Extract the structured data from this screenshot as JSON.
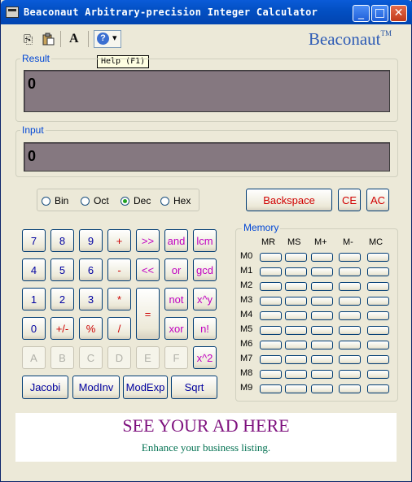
{
  "window": {
    "title": "Beaconaut Arbitrary-precision Integer Calculator",
    "minimize_label": "_",
    "maximize_label": "□",
    "close_label": "✕"
  },
  "toolbar": {
    "copy_icon": "⎘",
    "paste_icon": "📋",
    "font_icon": "A",
    "help_icon": "?",
    "dropdown_icon": "▾",
    "tooltip": "Help (F1)"
  },
  "logo": {
    "text": "Beaconaut",
    "tm": "TM"
  },
  "result": {
    "label": "Result",
    "value": "0"
  },
  "input": {
    "label": "Input",
    "value": "0"
  },
  "base": {
    "options": [
      "Bin",
      "Oct",
      "Dec",
      "Hex"
    ],
    "selected": "Dec"
  },
  "edit": {
    "backspace": "Backspace",
    "ce": "CE",
    "ac": "AC"
  },
  "keypad": {
    "k7": "7",
    "k8": "8",
    "k9": "9",
    "plus": "+",
    "shr": ">>",
    "and": "and",
    "lcm": "lcm",
    "k4": "4",
    "k5": "5",
    "k6": "6",
    "minus": "-",
    "shl": "<<",
    "or": "or",
    "gcd": "gcd",
    "k1": "1",
    "k2": "2",
    "k3": "3",
    "mul": "*",
    "eq": "=",
    "not": "not",
    "pow": "x^y",
    "k0": "0",
    "sign": "+/-",
    "mod": "%",
    "div": "/",
    "xor": "xor",
    "fact": "n!",
    "ka": "A",
    "kb": "B",
    "kc": "C",
    "kd": "D",
    "ke": "E",
    "kf": "F",
    "sq": "x^2",
    "jacobi": "Jacobi",
    "modinv": "ModInv",
    "modexp": "ModExp",
    "sqrt": "Sqrt"
  },
  "memory": {
    "label": "Memory",
    "columns": [
      "MR",
      "MS",
      "M+",
      "M-",
      "MC"
    ],
    "rows": [
      "M0",
      "M1",
      "M2",
      "M3",
      "M4",
      "M5",
      "M6",
      "M7",
      "M8",
      "M9"
    ]
  },
  "ad": {
    "title": "SEE YOUR AD HERE",
    "subtitle": "Enhance your business listing."
  }
}
